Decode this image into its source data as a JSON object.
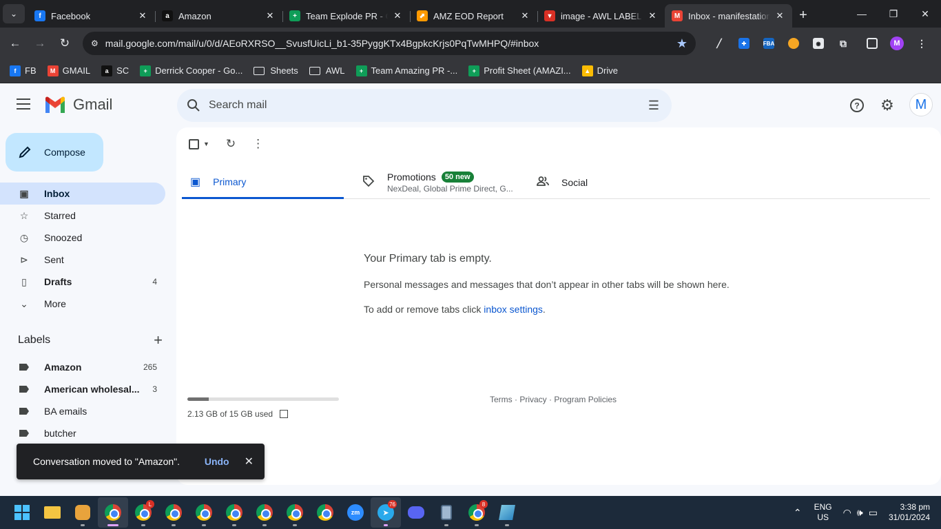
{
  "browser": {
    "tabs": [
      {
        "title": "Facebook",
        "color": "#1877f2",
        "glyph": "f"
      },
      {
        "title": "Amazon",
        "color": "#111111",
        "glyph": "a"
      },
      {
        "title": "Team Explode PR - Go",
        "color": "#0f9d58",
        "glyph": "+"
      },
      {
        "title": "AMZ EOD Report",
        "color": "#ff9900",
        "glyph": "⬈"
      },
      {
        "title": "image - AWL LABEL",
        "color": "#d93025",
        "glyph": "▾"
      },
      {
        "title": "Inbox - manifestation",
        "color": "#ea4335",
        "glyph": "M",
        "active": true
      }
    ],
    "url": "mail.google.com/mail/u/0/d/AEoRXRSO__SvusfUicLi_b1-35PyggKTx4BgpkcKrjs0PqTwMHPQ/#inbox",
    "bookmarks": [
      {
        "label": "FB",
        "color": "#1877f2",
        "glyph": "f"
      },
      {
        "label": "GMAIL",
        "color": "#ea4335",
        "glyph": "M"
      },
      {
        "label": "SC",
        "color": "#111111",
        "glyph": "a"
      },
      {
        "label": "Derrick Cooper - Go...",
        "color": "#0f9d58",
        "glyph": "+"
      },
      {
        "label": "Sheets",
        "folder": true
      },
      {
        "label": "AWL",
        "folder": true
      },
      {
        "label": "Team Amazing PR -...",
        "color": "#0f9d58",
        "glyph": "+"
      },
      {
        "label": "Profit Sheet (AMAZI...",
        "color": "#0f9d58",
        "glyph": "+"
      },
      {
        "label": "Drive",
        "color": "#fbbc04",
        "glyph": "▲"
      }
    ],
    "profile_initial": "M"
  },
  "gmail": {
    "app_name": "Gmail",
    "search_placeholder": "Search mail",
    "avatar_initial": "M",
    "compose_label": "Compose",
    "nav": [
      {
        "label": "Inbox",
        "icon": "inbox-icon",
        "glyph": "▣",
        "active": true,
        "count": ""
      },
      {
        "label": "Starred",
        "icon": "star-icon",
        "glyph": "☆",
        "count": ""
      },
      {
        "label": "Snoozed",
        "icon": "clock-icon",
        "glyph": "◷",
        "count": ""
      },
      {
        "label": "Sent",
        "icon": "send-icon",
        "glyph": "⊳",
        "count": ""
      },
      {
        "label": "Drafts",
        "icon": "draft-icon",
        "glyph": "▯",
        "count": "4",
        "bold": true
      },
      {
        "label": "More",
        "icon": "chevron-down-icon",
        "glyph": "⌄",
        "count": ""
      }
    ],
    "labels_title": "Labels",
    "labels": [
      {
        "label": "Amazon",
        "count": "265",
        "bold": true
      },
      {
        "label": "American wholesal...",
        "count": "3",
        "bold": true
      },
      {
        "label": "BA emails",
        "count": ""
      },
      {
        "label": "butcher",
        "count": ""
      }
    ],
    "category_tabs": {
      "primary": "Primary",
      "promotions": "Promotions",
      "promotions_badge": "50 new",
      "promotions_senders": "NexDeal, Global Prime Direct, G...",
      "social": "Social"
    },
    "empty_state": {
      "heading": "Your Primary tab is empty.",
      "body": "Personal messages and messages that don’t appear in other tabs will be shown here.",
      "hint_prefix": "To add or remove tabs click ",
      "hint_link": "inbox settings",
      "hint_suffix": "."
    },
    "storage": {
      "text": "2.13 GB of 15 GB used",
      "fraction": 0.142
    },
    "footer": {
      "terms": "Terms",
      "privacy": "Privacy",
      "policies": "Program Policies",
      "sep": " · "
    },
    "snackbar": {
      "message": "Conversation moved to \"Amazon\".",
      "action": "Undo"
    }
  },
  "taskbar": {
    "lang_line1": "ENG",
    "lang_line2": "US",
    "time": "3:38 pm",
    "date": "31/01/2024",
    "badges": {
      "chrome2": "L",
      "telegram": "76",
      "chrome_last": "8"
    }
  }
}
